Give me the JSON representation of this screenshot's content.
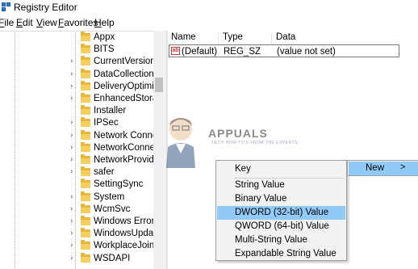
{
  "window": {
    "title": "Registry Editor",
    "icon": "registry-icon"
  },
  "menu": [
    {
      "label": "File",
      "u": "F",
      "rest": "ile"
    },
    {
      "label": "Edit",
      "u": "E",
      "rest": "dit"
    },
    {
      "label": "View",
      "u": "V",
      "rest": "iew"
    },
    {
      "label": "Favorites",
      "u": "F",
      "rest": "avorites"
    },
    {
      "label": "Help",
      "u": "H",
      "rest": "elp"
    }
  ],
  "tree": {
    "items": [
      {
        "label": "Appx",
        "expandable": false
      },
      {
        "label": "BITS",
        "expandable": false
      },
      {
        "label": "CurrentVersion",
        "expandable": true
      },
      {
        "label": "DataCollection",
        "expandable": true
      },
      {
        "label": "DeliveryOptimiza",
        "expandable": true
      },
      {
        "label": "EnhancedStorage",
        "expandable": true
      },
      {
        "label": "Installer",
        "expandable": false
      },
      {
        "label": "IPSec",
        "expandable": true
      },
      {
        "label": "Network Connect",
        "expandable": true
      },
      {
        "label": "NetworkConnecti",
        "expandable": true
      },
      {
        "label": "NetworkProvider",
        "expandable": true
      },
      {
        "label": "safer",
        "expandable": true
      },
      {
        "label": "SettingSync",
        "expandable": false
      },
      {
        "label": "System",
        "expandable": true
      },
      {
        "label": "WcmSvc",
        "expandable": true
      },
      {
        "label": "Windows Error Re",
        "expandable": true
      },
      {
        "label": "WindowsUpdate",
        "expandable": true
      },
      {
        "label": "WorkplaceJoin",
        "expandable": true
      },
      {
        "label": "WSDAPI",
        "expandable": true
      }
    ]
  },
  "values_pane": {
    "columns": [
      "Name",
      "Type",
      "Data"
    ],
    "rows": [
      {
        "name": "(Default)",
        "type": "REG_SZ",
        "data": "(value not set)"
      }
    ]
  },
  "watermark": {
    "text": "APPUALS",
    "subtext": "TECH HOW-TO'S FROM THE EXPERTS!"
  },
  "context_menu": {
    "items": [
      {
        "label": "Key",
        "highlighted": false
      },
      {
        "label": "String Value",
        "highlighted": false
      },
      {
        "label": "Binary Value",
        "highlighted": false
      },
      {
        "label": "DWORD (32-bit) Value",
        "highlighted": true
      },
      {
        "label": "QWORD (64-bit) Value",
        "highlighted": false
      },
      {
        "label": "Multi-String Value",
        "highlighted": false
      },
      {
        "label": "Expandable String Value",
        "highlighted": false
      }
    ]
  },
  "parent_menu": {
    "label": "New",
    "submenu_arrow": ">"
  },
  "colors": {
    "highlight": "#91c9f7",
    "folder": "#e8b73a",
    "menu_bg": "#f2f2f2"
  }
}
